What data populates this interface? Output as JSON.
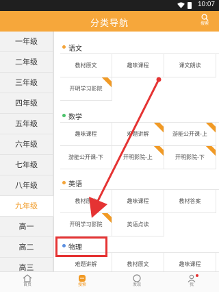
{
  "status_bar": {
    "time": "10:07"
  },
  "header": {
    "title": "分类导航",
    "search_label": "搜索"
  },
  "sidebar": {
    "items": [
      {
        "label": "一年级",
        "active": false
      },
      {
        "label": "二年级",
        "active": false
      },
      {
        "label": "三年级",
        "active": false
      },
      {
        "label": "四年级",
        "active": false
      },
      {
        "label": "五年级",
        "active": false
      },
      {
        "label": "六年级",
        "active": false
      },
      {
        "label": "七年级",
        "active": false
      },
      {
        "label": "八年级",
        "active": false
      },
      {
        "label": "九年级",
        "active": true
      },
      {
        "label": "高一",
        "active": false
      },
      {
        "label": "高二",
        "active": false
      },
      {
        "label": "高三",
        "active": false
      }
    ]
  },
  "sections": [
    {
      "name": "语文",
      "dot_color": "#f3a43a",
      "items": [
        {
          "label": "教材原文",
          "badge": false
        },
        {
          "label": "趣味课程",
          "badge": false
        },
        {
          "label": "课文朗读",
          "badge": false
        },
        {
          "label": "开明学习影院",
          "badge": true
        }
      ]
    },
    {
      "name": "数学",
      "dot_color": "#4cc26b",
      "items": [
        {
          "label": "趣味课程",
          "badge": false
        },
        {
          "label": "难题讲解",
          "badge": true
        },
        {
          "label": "游能公开课-上",
          "badge": true
        },
        {
          "label": "游能公开课-下",
          "badge": false
        },
        {
          "label": "开明影院-上",
          "badge": true
        },
        {
          "label": "开明影院-下",
          "badge": true
        }
      ]
    },
    {
      "name": "英语",
      "dot_color": "#f3a43a",
      "items": [
        {
          "label": "教材原文",
          "badge": false
        },
        {
          "label": "趣味课程",
          "badge": false
        },
        {
          "label": "教材答案",
          "badge": false
        },
        {
          "label": "开明学习影院",
          "badge": true
        },
        {
          "label": "英语点读",
          "badge": false
        }
      ]
    },
    {
      "name": "物理",
      "dot_color": "#5b8fe0",
      "items": [
        {
          "label": "难题讲解",
          "badge": false
        },
        {
          "label": "教材原文",
          "badge": false
        },
        {
          "label": "趣味课程",
          "badge": false
        }
      ]
    }
  ],
  "tabbar": {
    "items": [
      {
        "label": "首页",
        "icon": "home-icon",
        "active": false
      },
      {
        "label": "搜索",
        "icon": "category-icon",
        "active": true
      },
      {
        "label": "发现",
        "icon": "compass-icon",
        "active": false
      },
      {
        "label": "我",
        "icon": "person-icon",
        "active": false,
        "notification": true
      }
    ]
  },
  "colors": {
    "accent": "#f6a73b",
    "highlight": "#e53333"
  }
}
